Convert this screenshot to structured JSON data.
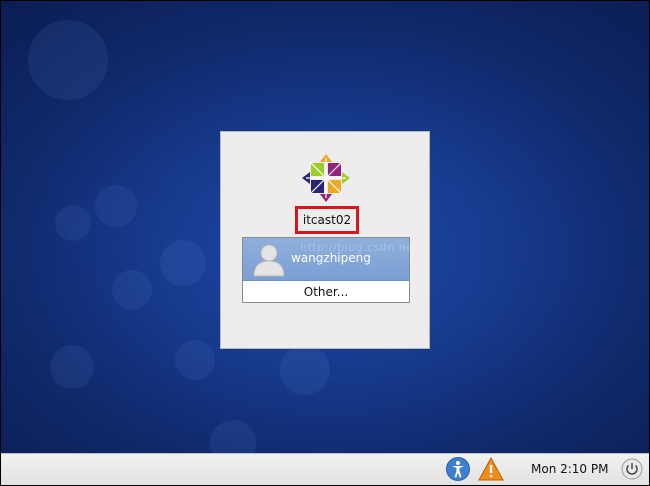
{
  "screen": {
    "background_color": "#17398c",
    "watermark": "http://blog.csdn.net/"
  },
  "login": {
    "logo_icon": "centos-logo-icon",
    "hostname": "itcast02",
    "hostname_highlight_color": "#d9161c",
    "users": [
      {
        "name": "wangzhipeng",
        "icon": "user-avatar-icon",
        "selected": true
      }
    ],
    "other_label": "Other...",
    "selection_color": "#7a9fd3"
  },
  "panel": {
    "accessibility_icon": "accessibility-icon",
    "warning_icon": "warning-icon",
    "clock": "Mon  2:10 PM",
    "power_icon": "power-icon"
  }
}
